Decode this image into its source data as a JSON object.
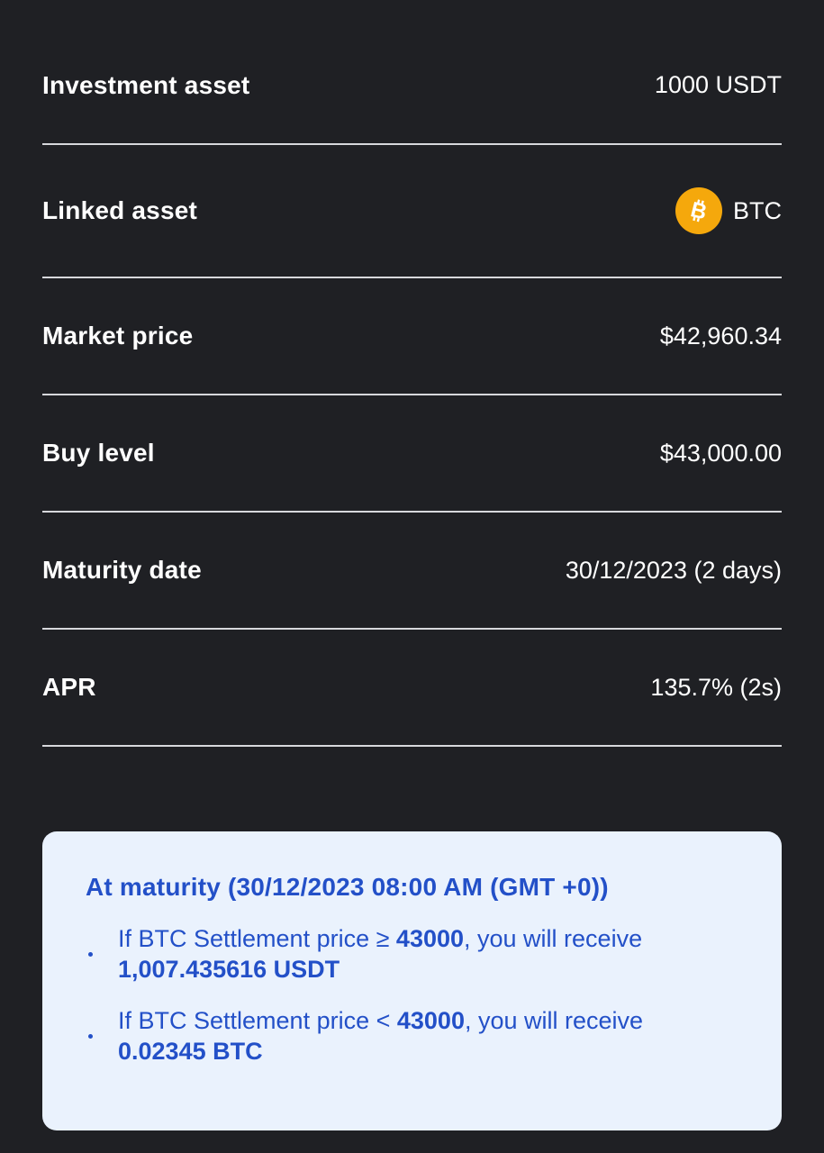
{
  "details": {
    "investment_asset": {
      "label": "Investment asset",
      "value": "1000 USDT"
    },
    "linked_asset": {
      "label": "Linked asset",
      "value": "BTC",
      "icon": "bitcoin-icon",
      "icon_color": "#f5a80c"
    },
    "market_price": {
      "label": "Market price",
      "value": "$42,960.34"
    },
    "buy_level": {
      "label": "Buy level",
      "value": "$43,000.00"
    },
    "maturity_date": {
      "label": "Maturity date",
      "value": "30/12/2023 (2 days)"
    },
    "apr": {
      "label": "APR",
      "value": "135.7% (2s)"
    }
  },
  "maturity_info": {
    "title": "At maturity (30/12/2023 08:00 AM (GMT +0))",
    "outcomes": [
      {
        "prefix": "If BTC Settlement price ≥ ",
        "price": "43000",
        "middle": ", you will receive",
        "amount": "1,007.435616 USDT"
      },
      {
        "prefix": "If BTC Settlement price < ",
        "price": "43000",
        "middle": ", you will receive",
        "amount": "0.02345 BTC"
      }
    ]
  },
  "colors": {
    "background": "#1f2024",
    "card_background": "#eaf2fd",
    "accent_blue": "#2350c8",
    "divider": "#d7d8dc"
  }
}
